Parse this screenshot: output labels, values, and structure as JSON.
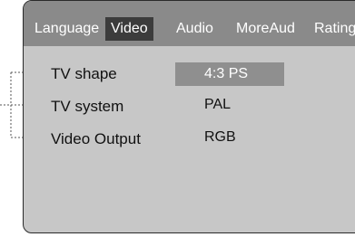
{
  "tabs": [
    {
      "label": "Language",
      "active": false
    },
    {
      "label": "Video",
      "active": true
    },
    {
      "label": "Audio",
      "active": false
    },
    {
      "label": "MoreAud",
      "active": false
    },
    {
      "label": "Rating",
      "active": false
    }
  ],
  "settings": [
    {
      "label": "TV shape",
      "value": "4:3 PS",
      "selected": true
    },
    {
      "label": "TV system",
      "value": "PAL",
      "selected": false
    },
    {
      "label": "Video Output",
      "value": "RGB",
      "selected": false
    }
  ],
  "colors": {
    "panel_bg": "#c7c7c7",
    "tabbar_bg": "#8a8a8a",
    "active_tab_bg": "#3c3c3c",
    "selected_value_bg": "#8f8f8f"
  }
}
